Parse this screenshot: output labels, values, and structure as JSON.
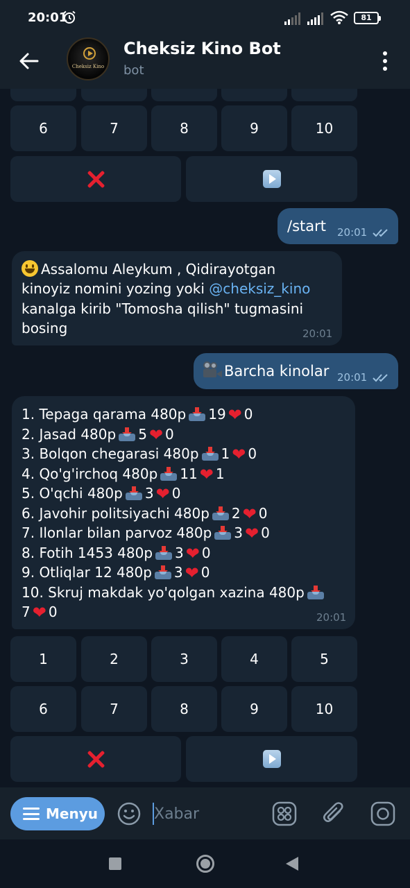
{
  "status_bar": {
    "time": "20:01",
    "battery": "81",
    "icons": [
      "alarm-icon",
      "signal-icon",
      "signal-icon",
      "wifi-icon",
      "battery-icon"
    ]
  },
  "header": {
    "title": "Cheksiz Kino Bot",
    "subtitle": "bot",
    "avatar_text": "Cheksiz Kino",
    "back_icon": "arrow-left-icon",
    "menu_icon": "more-vertical-icon"
  },
  "keyboard_top": {
    "row": [
      "6",
      "7",
      "8",
      "9",
      "10"
    ],
    "close_icon": "cross-mark-icon",
    "next_icon": "play-button-icon"
  },
  "messages": [
    {
      "direction": "outgoing",
      "text": "/start",
      "time": "20:01"
    },
    {
      "direction": "incoming",
      "lines": [
        "Assalomu Aleykum , Qidirayotgan",
        "kinoyiz nomini yozing yoki",
        "@cheksiz_kino",
        "kanalga kirib \"Tomosha qilish\" tugmasini",
        "bosing"
      ],
      "time": "20:01"
    },
    {
      "direction": "outgoing",
      "text": "Barcha kinolar",
      "time": "20:01"
    },
    {
      "direction": "incoming",
      "time": "20:01",
      "list": [
        {
          "title": "1. Tepaga qarama 480p",
          "downloads": "19",
          "likes": "0"
        },
        {
          "title": "2. Jasad 480p",
          "downloads": "5",
          "likes": "0"
        },
        {
          "title": "3. Bolqon chegarasi 480p",
          "downloads": "1",
          "likes": "0"
        },
        {
          "title": "4. Qo'g'irchoq 480p",
          "downloads": "11",
          "likes": "1"
        },
        {
          "title": "5. O'qchi 480p",
          "downloads": "3",
          "likes": "0"
        },
        {
          "title": "6. Javohir politsiyachi 480p",
          "downloads": "2",
          "likes": "0"
        },
        {
          "title": "7. Ilonlar bilan parvoz 480p",
          "downloads": "3",
          "likes": "0"
        },
        {
          "title": "8. Fotih 1453 480p",
          "downloads": "3",
          "likes": "0"
        },
        {
          "title": "9. Otliqlar 12 480p",
          "downloads": "3",
          "likes": "0"
        },
        {
          "title": "10. Skruj makdak yo'qolgan xazina 480p",
          "downloads": "7",
          "likes": "0"
        }
      ]
    }
  ],
  "keyboard": {
    "row1": [
      "1",
      "2",
      "3",
      "4",
      "5"
    ],
    "row2": [
      "6",
      "7",
      "8",
      "9",
      "10"
    ],
    "close_icon": "cross-mark-icon",
    "next_icon": "play-button-icon"
  },
  "input_bar": {
    "menu_label": "Menyu",
    "placeholder": "Xabar",
    "icons": [
      "emoji-icon",
      "bot-commands-icon",
      "attach-icon",
      "camera-icon"
    ]
  },
  "nav_bar": {
    "icons": [
      "recents-icon",
      "home-icon",
      "back-icon"
    ]
  },
  "colors": {
    "background": "#0e1621",
    "header": "#17212b",
    "bubble_in": "#182533",
    "bubble_out": "#2b5278",
    "accent": "#5c9ce0",
    "link": "#6ab3f3"
  }
}
